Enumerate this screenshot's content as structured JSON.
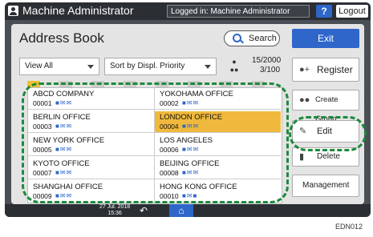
{
  "topbar": {
    "machine_admin": "Machine Administrator",
    "logged_in": "Logged in: Machine Administrator",
    "help": "?",
    "logout": "Logout"
  },
  "header": {
    "title": "Address Book",
    "search": "Search",
    "exit": "Exit"
  },
  "filters": {
    "view": "View All",
    "sort": "Sort by Displ. Priority"
  },
  "counts": {
    "total": "15/2000",
    "page": "3/100"
  },
  "actions": {
    "register": "Register",
    "create_group": "Create Group",
    "edit": "Edit",
    "delete": "Delete",
    "management": "Management"
  },
  "entries": [
    {
      "name": "ABCD COMPANY",
      "number": "00001"
    },
    {
      "name": "YOKOHAMA OFFICE",
      "number": "00002"
    },
    {
      "name": "BERLIN OFFICE",
      "number": "00003"
    },
    {
      "name": "LONDON OFFICE",
      "number": "00004",
      "selected": true
    },
    {
      "name": "NEW YORK OFFICE",
      "number": "00005"
    },
    {
      "name": "LOS ANGELES",
      "number": "00006"
    },
    {
      "name": "KYOTO OFFICE",
      "number": "00007"
    },
    {
      "name": "BEIJING OFFICE",
      "number": "00008"
    },
    {
      "name": "SHANGHAI OFFICE",
      "number": "00009"
    },
    {
      "name": "HONG KONG OFFICE",
      "number": "00010"
    }
  ],
  "footer": {
    "date": "27 Jul. 2018",
    "time": "15:36"
  },
  "figure_id": "EDN012",
  "colors": {
    "accent": "#2e66c9",
    "highlight": "#1c8a3c",
    "selected": "#f0b93d"
  }
}
